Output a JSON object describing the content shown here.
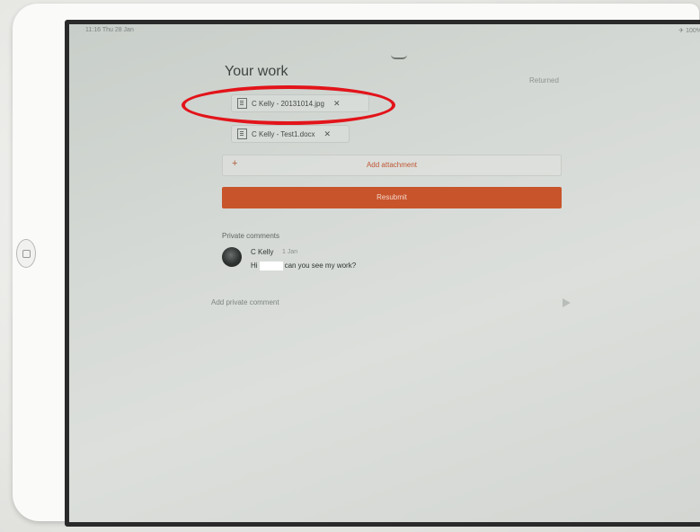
{
  "status_bar": {
    "time": "11:16  Thu 28 Jan",
    "icons": "✈ 100%"
  },
  "header": {
    "title": "Your work",
    "status": "Returned"
  },
  "attachments": [
    {
      "name": "C Kelly - 20131014.jpg",
      "remove": "✕"
    },
    {
      "name": "C Kelly - Test1.docx",
      "remove": "✕"
    }
  ],
  "add_attachment": {
    "plus": "+",
    "label": "Add attachment"
  },
  "resubmit": {
    "label": "Resubmit"
  },
  "comments": {
    "section_label": "Private comments",
    "items": [
      {
        "author": "C Kelly",
        "time": "1 Jan",
        "text_before": "Hi",
        "text_after": "can you see my work?"
      }
    ]
  },
  "private_comment": {
    "placeholder": "Add private comment"
  },
  "colors": {
    "accent": "#c8542b",
    "highlight": "#e2141a"
  }
}
